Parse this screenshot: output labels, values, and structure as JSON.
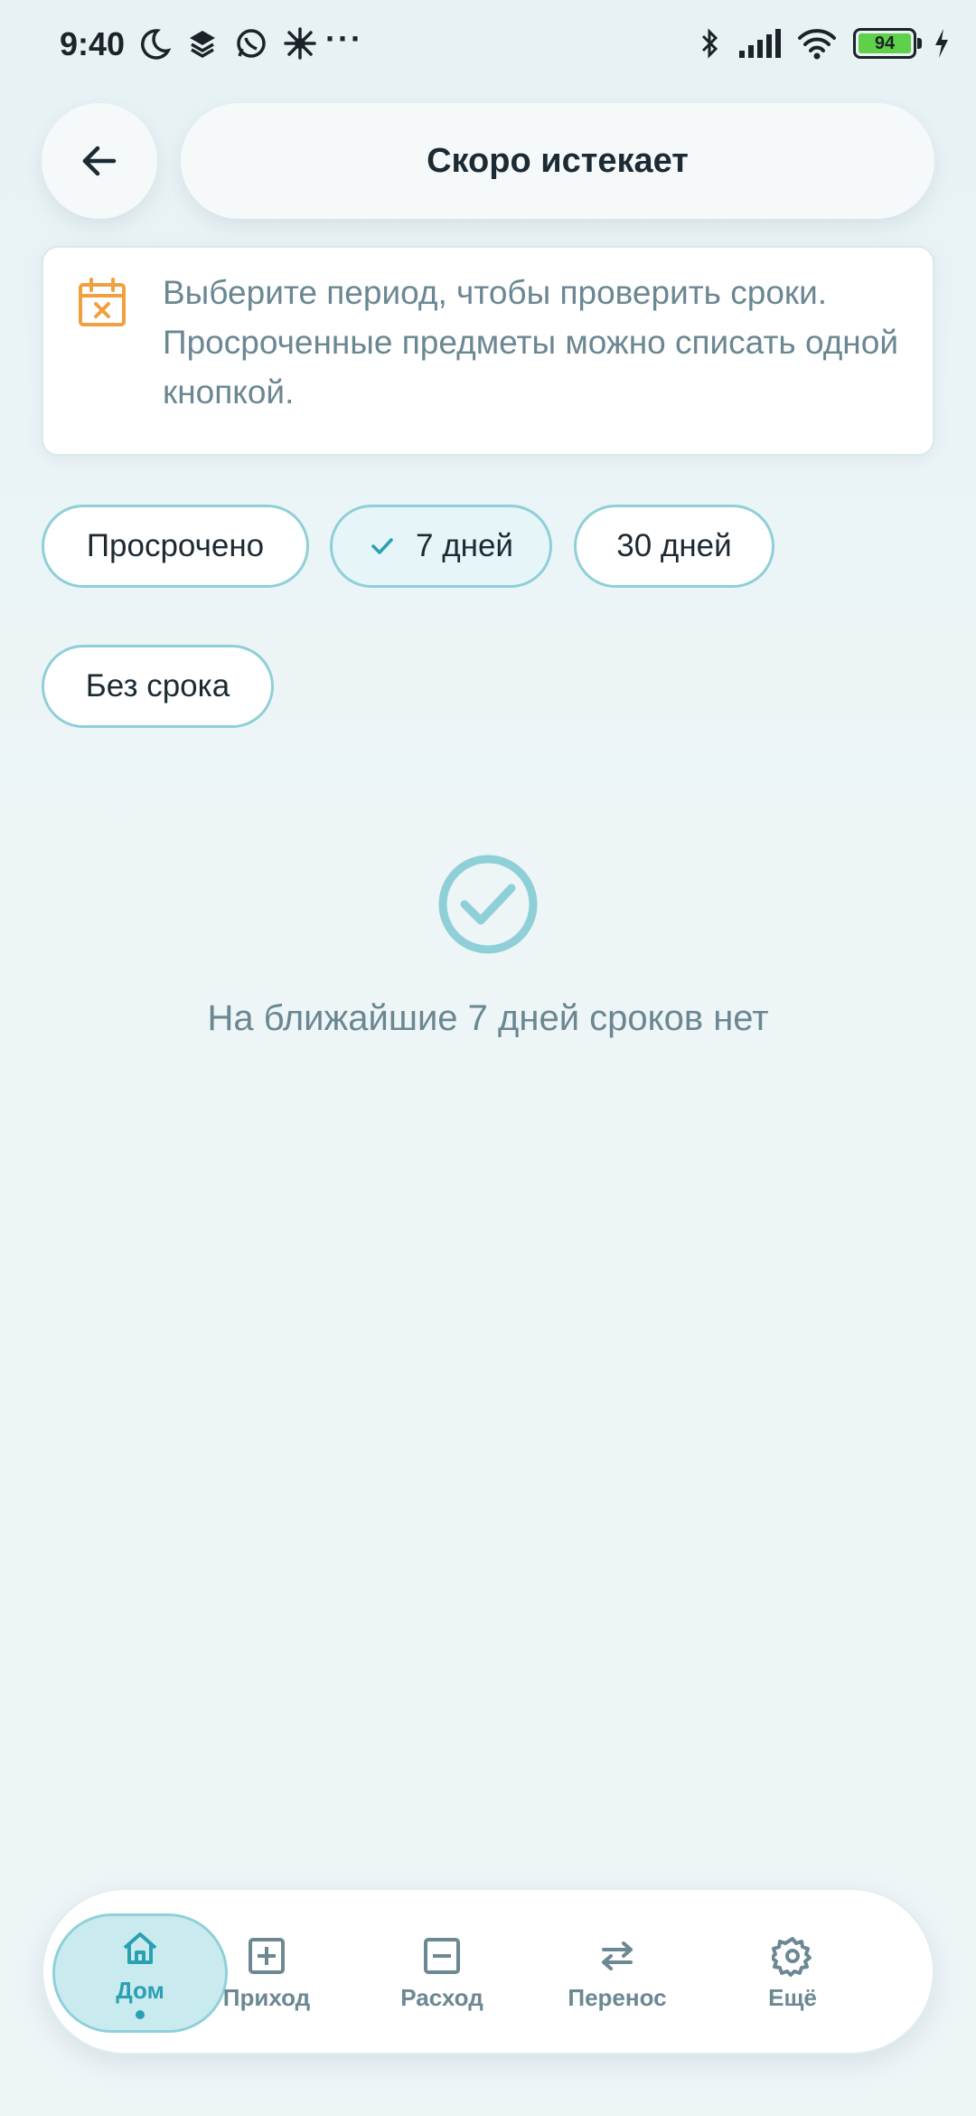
{
  "status_bar": {
    "time": "9:40",
    "left_icons": [
      "moon-icon",
      "layers-icon",
      "whatsapp-icon",
      "sparkle-icon"
    ],
    "overflow": "···",
    "right_icons": [
      "bluetooth-icon",
      "signal-icon",
      "wifi-icon",
      "charging-icon"
    ],
    "battery_level": "94"
  },
  "header": {
    "back_icon": "arrow-left-icon",
    "title": "Скоро истекает"
  },
  "info_card": {
    "icon": "calendar-x-icon",
    "text": "Выберите период, чтобы проверить сроки. Просроченные предметы можно списать одной кнопкой."
  },
  "filters": {
    "chips": [
      {
        "label": "Просрочено",
        "selected": false
      },
      {
        "label": "7 дней",
        "selected": true
      },
      {
        "label": "30 дней",
        "selected": false
      },
      {
        "label": "Без срока",
        "selected": false
      }
    ]
  },
  "empty_state": {
    "icon": "check-circle-icon",
    "message": "На ближайшие 7 дней сроков нет"
  },
  "bottom_nav": {
    "items": [
      {
        "label": "Дом",
        "icon": "home-icon",
        "active": true
      },
      {
        "label": "Приход",
        "icon": "plus-square-icon",
        "active": false
      },
      {
        "label": "Расход",
        "icon": "minus-square-icon",
        "active": false
      },
      {
        "label": "Перенос",
        "icon": "transfer-icon",
        "active": false
      },
      {
        "label": "Ещё",
        "icon": "gear-icon",
        "active": false
      }
    ]
  },
  "colors": {
    "accent": "#2aa0b2",
    "chip_border": "#8fcfd8",
    "warning_icon": "#f0a040",
    "muted_text": "#6a8792",
    "background": "#eef5f7"
  }
}
